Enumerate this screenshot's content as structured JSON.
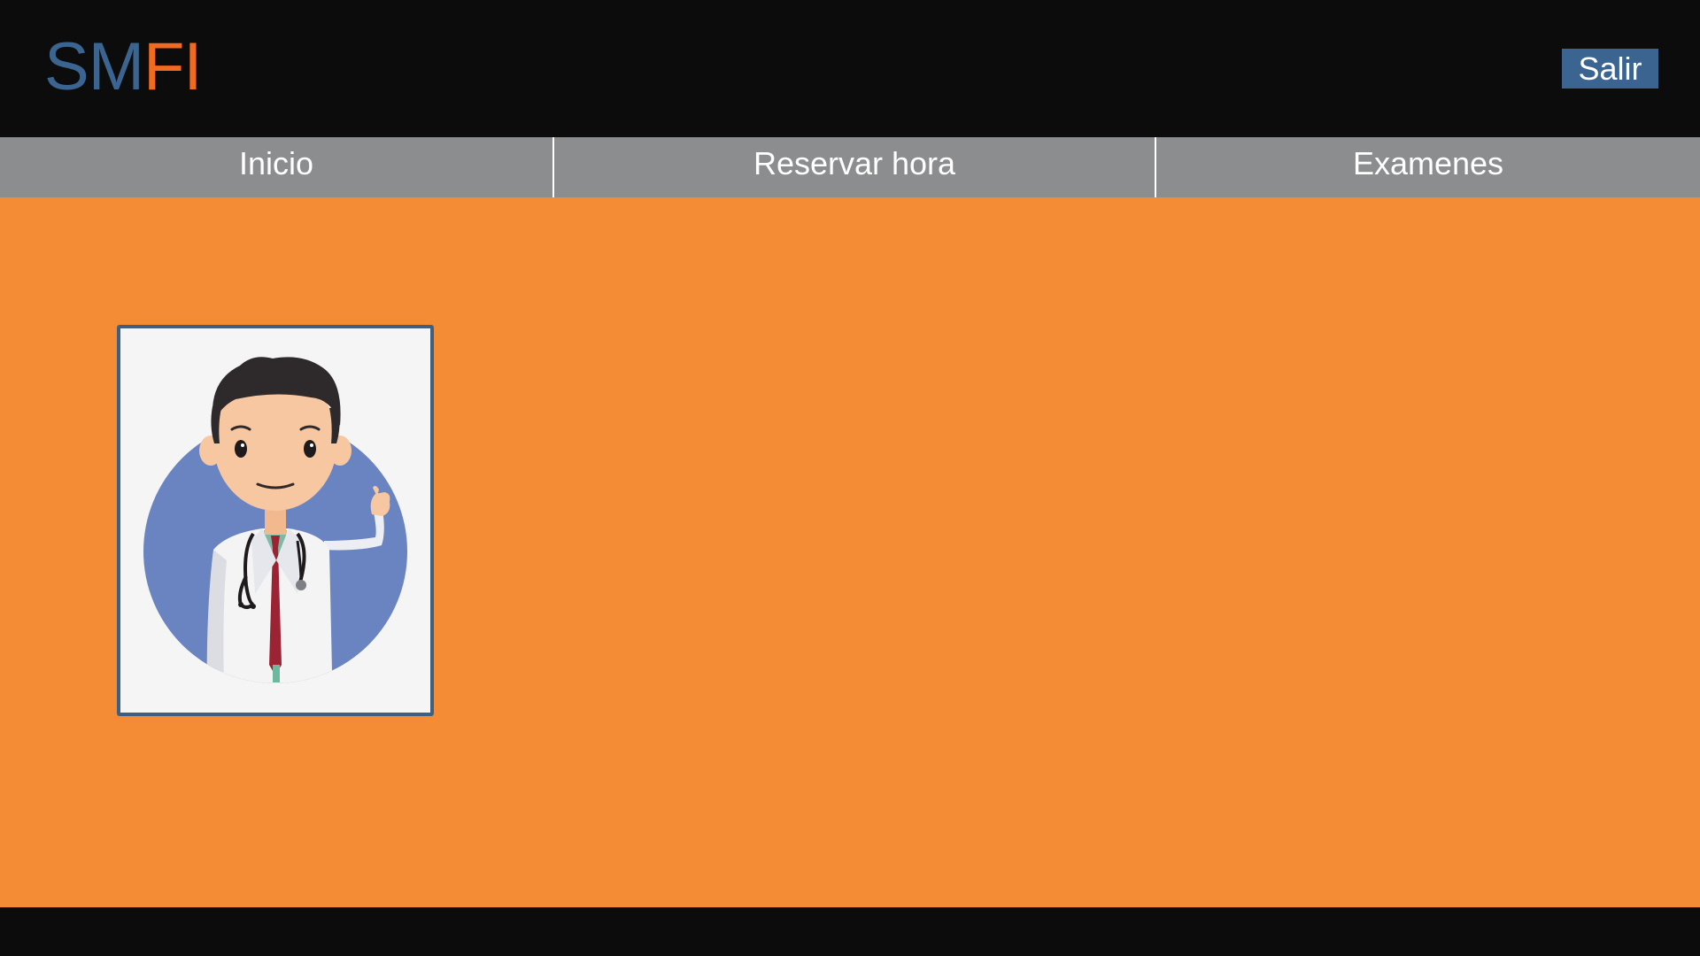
{
  "app": {
    "logo_part1": "SM",
    "logo_part2": "FI"
  },
  "header": {
    "logout_label": "Salir"
  },
  "nav": {
    "items": [
      {
        "label": "Inicio"
      },
      {
        "label": "Reservar hora"
      },
      {
        "label": "Examenes"
      }
    ]
  },
  "colors": {
    "background": "#f38c35",
    "header": "#0c0c0d",
    "nav": "#8c8d8f",
    "accent_blue": "#3b6590",
    "accent_orange": "#f26a1f"
  },
  "illustration": {
    "icon": "doctor-illustration"
  }
}
